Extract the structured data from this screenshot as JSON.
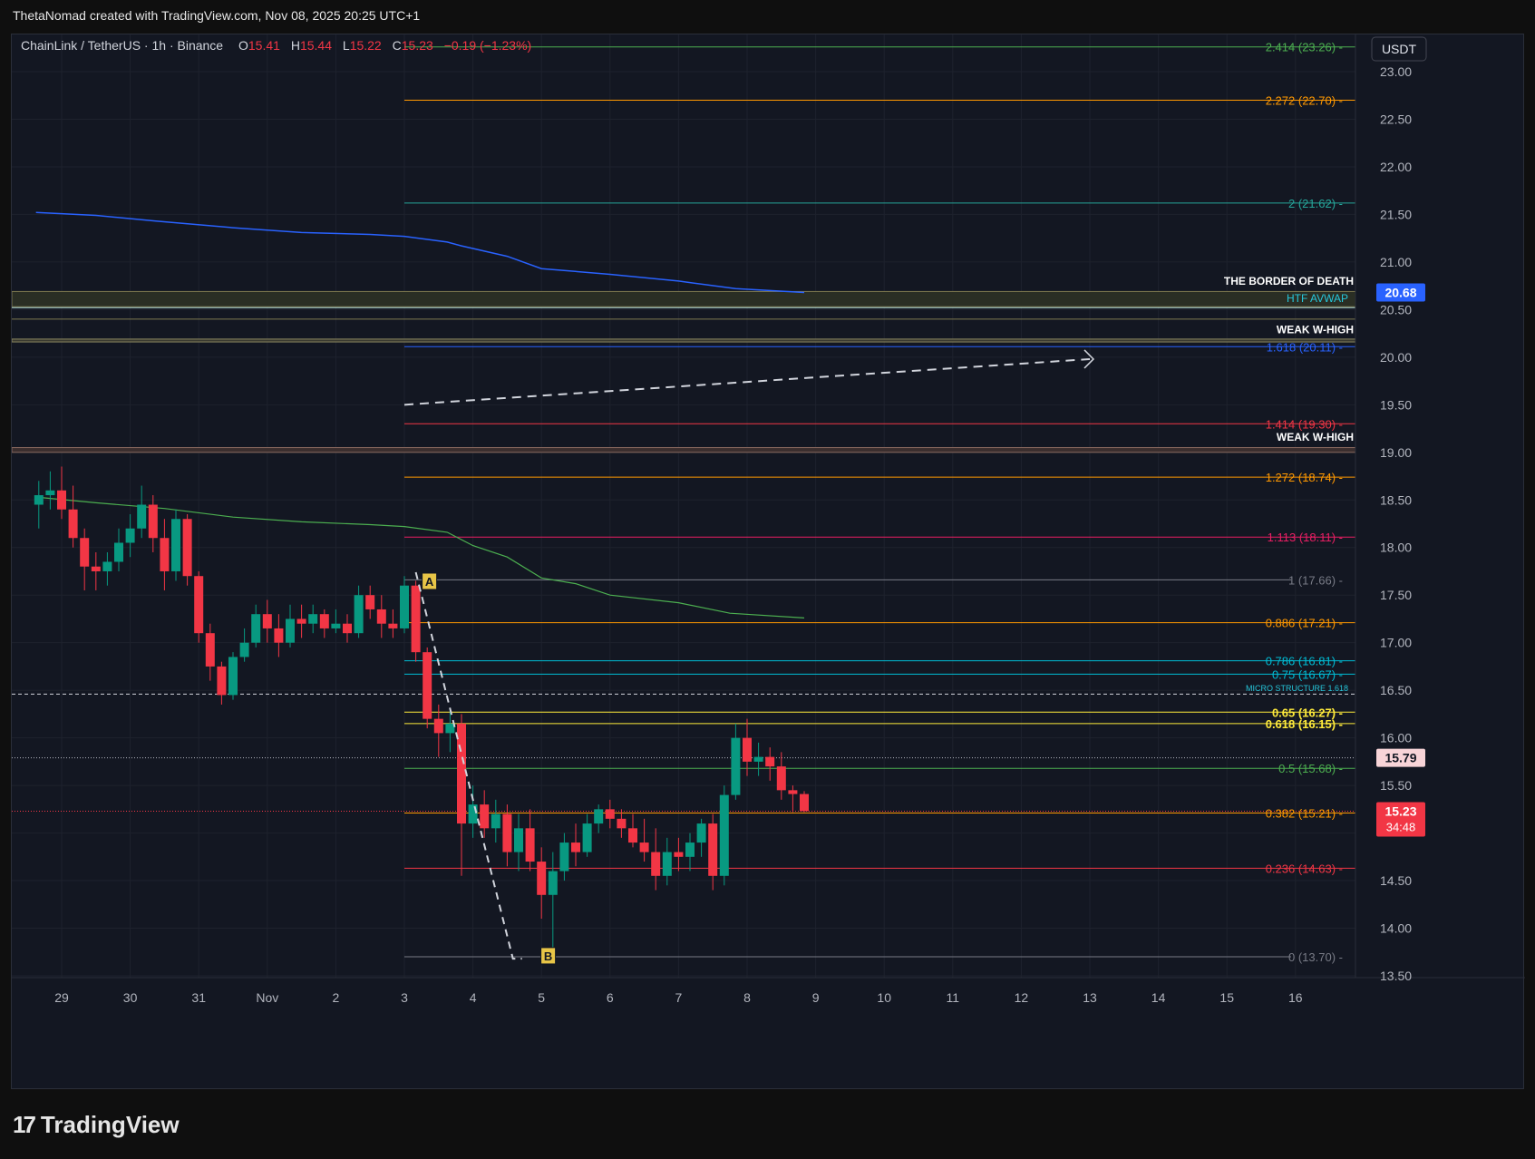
{
  "header": {
    "credit": "ThetaNomad created with TradingView.com, Nov 08, 2025 20:25 UTC+1"
  },
  "legend": {
    "symbol": "ChainLink / TetherUS · 1h · Binance",
    "o_label": "O",
    "o_value": "15.41",
    "h_label": "H",
    "h_value": "15.44",
    "l_label": "L",
    "l_value": "15.22",
    "c_label": "C",
    "c_value": "15.23",
    "change": "−0.19 (−1.23%)"
  },
  "price_axis": {
    "currency_button": "USDT",
    "ticks": [
      "23.00",
      "22.50",
      "22.00",
      "21.50",
      "21.00",
      "20.50",
      "20.00",
      "19.50",
      "19.00",
      "18.50",
      "18.00",
      "17.50",
      "17.00",
      "16.50",
      "16.00",
      "15.50",
      "14.50",
      "14.00",
      "13.50"
    ],
    "tag_avwap": "20.68",
    "tag_marker": "15.79",
    "tag_last": "15.23",
    "tag_countdown": "34:48"
  },
  "time_axis": {
    "labels": [
      "29",
      "30",
      "31",
      "Nov",
      "2",
      "3",
      "4",
      "5",
      "6",
      "7",
      "8",
      "9",
      "10",
      "11",
      "12",
      "13",
      "14",
      "15",
      "16"
    ]
  },
  "fib_levels": [
    {
      "label": "2.414 (23.26)",
      "price": 23.26,
      "color": "#4caf50"
    },
    {
      "label": "2.272 (22.70)",
      "price": 22.7,
      "color": "#ff9800"
    },
    {
      "label": "2 (21.62)",
      "price": 21.62,
      "color": "#26a69a"
    },
    {
      "label": "1.618 (20.11)",
      "price": 20.11,
      "color": "#2962ff"
    },
    {
      "label": "1.414 (19.30)",
      "price": 19.3,
      "color": "#f23645"
    },
    {
      "label": "1.272 (18.74)",
      "price": 18.74,
      "color": "#ff9800"
    },
    {
      "label": "1.113 (18.11)",
      "price": 18.11,
      "color": "#e91e63"
    },
    {
      "label": "1 (17.66)",
      "price": 17.66,
      "color": "#787b86"
    },
    {
      "label": "0.886 (17.21)",
      "price": 17.21,
      "color": "#ff9800"
    },
    {
      "label": "0.786 (16.81)",
      "price": 16.81,
      "color": "#00bcd4"
    },
    {
      "label": "0.75 (16.67)",
      "price": 16.67,
      "color": "#00bcd4"
    },
    {
      "label": "0.65 (16.27)",
      "price": 16.27,
      "color": "#ffeb3b"
    },
    {
      "label": "0.618 (16.15)",
      "price": 16.15,
      "color": "#ffeb3b"
    },
    {
      "label": "0.5 (15.68)",
      "price": 15.68,
      "color": "#4caf50"
    },
    {
      "label": "0.382 (15.21)",
      "price": 15.21,
      "color": "#ff9800"
    },
    {
      "label": "0.236 (14.63)",
      "price": 14.63,
      "color": "#f23645"
    },
    {
      "label": "0 (13.70)",
      "price": 13.7,
      "color": "#787b86"
    }
  ],
  "annotations": {
    "border_of_death": "THE BORDER OF DEATH",
    "htf_avwap": "HTF AVWAP",
    "weak_w_high_1": "WEAK W-HIGH",
    "weak_w_high_2": "WEAK W-HIGH",
    "micro_structure": "MICRO STRUCTURE 1.618",
    "point_a": "A",
    "point_b": "B"
  },
  "chart_data": {
    "type": "candlestick",
    "title": "ChainLink / TetherUS · 1h · Binance",
    "xlabel": "",
    "ylabel": "",
    "ylim": [
      13.4,
      23.3
    ],
    "x_range": [
      "Oct 28 15:00",
      "Nov 16 20:00"
    ],
    "last_price": 15.23,
    "ohlc_last": {
      "open": 15.41,
      "high": 15.44,
      "low": 15.22,
      "close": 15.23
    },
    "colors": {
      "up": "#089981",
      "down": "#f23645",
      "avwap": "#2962ff",
      "ma": "#4caf50"
    },
    "avwap_line": [
      [
        "Oct 28 15:00",
        21.52
      ],
      [
        "Oct 29 12:00",
        21.49
      ],
      [
        "Oct 30 09:00",
        21.43
      ],
      [
        "Oct 31 12:00",
        21.36
      ],
      [
        "Nov 01 12:00",
        21.31
      ],
      [
        "Nov 02 12:00",
        21.29
      ],
      [
        "Nov 03 00:00",
        21.27
      ],
      [
        "Nov 03 15:00",
        21.21
      ],
      [
        "Nov 03 20:00",
        21.17
      ],
      [
        "Nov 04 12:00",
        21.06
      ],
      [
        "Nov 05 00:00",
        20.93
      ],
      [
        "Nov 06 00:00",
        20.87
      ],
      [
        "Nov 07 00:00",
        20.8
      ],
      [
        "Nov 07 20:00",
        20.72
      ],
      [
        "Nov 08 20:00",
        20.68
      ]
    ],
    "ma_line": [
      [
        "Oct 28 15:00",
        18.53
      ],
      [
        "Oct 29 12:00",
        18.47
      ],
      [
        "Oct 30 12:00",
        18.41
      ],
      [
        "Oct 31 12:00",
        18.32
      ],
      [
        "Nov 01 12:00",
        18.27
      ],
      [
        "Nov 02 12:00",
        18.24
      ],
      [
        "Nov 03 00:00",
        18.22
      ],
      [
        "Nov 03 15:00",
        18.16
      ],
      [
        "Nov 04 00:00",
        18.02
      ],
      [
        "Nov 04 12:00",
        17.9
      ],
      [
        "Nov 05 00:00",
        17.68
      ],
      [
        "Nov 05 12:00",
        17.62
      ],
      [
        "Nov 06 00:00",
        17.5
      ],
      [
        "Nov 07 00:00",
        17.42
      ],
      [
        "Nov 07 18:00",
        17.31
      ],
      [
        "Nov 08 20:00",
        17.26
      ]
    ],
    "candles": [
      [
        "Oct 28 16:00",
        18.45,
        18.7,
        18.2,
        18.55
      ],
      [
        "Oct 28 20:00",
        18.55,
        18.8,
        18.4,
        18.6
      ],
      [
        "Oct 29 00:00",
        18.6,
        18.85,
        18.3,
        18.4
      ],
      [
        "Oct 29 04:00",
        18.4,
        18.65,
        18.0,
        18.1
      ],
      [
        "Oct 29 08:00",
        18.1,
        18.2,
        17.55,
        17.8
      ],
      [
        "Oct 29 12:00",
        17.8,
        17.95,
        17.55,
        17.75
      ],
      [
        "Oct 29 16:00",
        17.75,
        17.95,
        17.6,
        17.85
      ],
      [
        "Oct 29 20:00",
        17.85,
        18.2,
        17.75,
        18.05
      ],
      [
        "Oct 30 00:00",
        18.05,
        18.35,
        17.9,
        18.2
      ],
      [
        "Oct 30 04:00",
        18.2,
        18.65,
        18.1,
        18.45
      ],
      [
        "Oct 30 08:00",
        18.45,
        18.55,
        17.95,
        18.1
      ],
      [
        "Oct 30 12:00",
        18.1,
        18.3,
        17.55,
        17.75
      ],
      [
        "Oct 30 16:00",
        17.75,
        18.4,
        17.65,
        18.3
      ],
      [
        "Oct 30 20:00",
        18.3,
        18.35,
        17.6,
        17.7
      ],
      [
        "Oct 31 00:00",
        17.7,
        17.75,
        17.0,
        17.1
      ],
      [
        "Oct 31 04:00",
        17.1,
        17.2,
        16.6,
        16.75
      ],
      [
        "Oct 31 08:00",
        16.75,
        16.8,
        16.35,
        16.45
      ],
      [
        "Oct 31 12:00",
        16.45,
        16.9,
        16.4,
        16.85
      ],
      [
        "Oct 31 16:00",
        16.85,
        17.15,
        16.8,
        17.0
      ],
      [
        "Oct 31 20:00",
        17.0,
        17.4,
        16.95,
        17.3
      ],
      [
        "Nov 01 00:00",
        17.3,
        17.45,
        17.0,
        17.15
      ],
      [
        "Nov 01 04:00",
        17.15,
        17.3,
        16.85,
        17.0
      ],
      [
        "Nov 01 08:00",
        17.0,
        17.4,
        16.95,
        17.25
      ],
      [
        "Nov 01 12:00",
        17.25,
        17.4,
        17.05,
        17.2
      ],
      [
        "Nov 01 16:00",
        17.2,
        17.4,
        17.1,
        17.3
      ],
      [
        "Nov 01 20:00",
        17.3,
        17.35,
        17.05,
        17.15
      ],
      [
        "Nov 02 00:00",
        17.15,
        17.35,
        17.1,
        17.2
      ],
      [
        "Nov 02 04:00",
        17.2,
        17.3,
        17.0,
        17.1
      ],
      [
        "Nov 02 08:00",
        17.1,
        17.6,
        17.05,
        17.5
      ],
      [
        "Nov 02 12:00",
        17.5,
        17.6,
        17.25,
        17.35
      ],
      [
        "Nov 02 16:00",
        17.35,
        17.5,
        17.05,
        17.2
      ],
      [
        "Nov 02 20:00",
        17.2,
        17.35,
        17.05,
        17.15
      ],
      [
        "Nov 03 00:00",
        17.15,
        17.7,
        17.1,
        17.6
      ],
      [
        "Nov 03 04:00",
        17.6,
        17.65,
        16.8,
        16.9
      ],
      [
        "Nov 03 08:00",
        16.9,
        16.95,
        16.1,
        16.2
      ],
      [
        "Nov 03 12:00",
        16.2,
        16.35,
        15.8,
        16.05
      ],
      [
        "Nov 03 16:00",
        16.05,
        16.3,
        15.85,
        16.15
      ],
      [
        "Nov 03 20:00",
        16.15,
        16.25,
        14.55,
        15.1
      ],
      [
        "Nov 04 00:00",
        15.1,
        15.5,
        14.95,
        15.3
      ],
      [
        "Nov 04 04:00",
        15.3,
        15.45,
        14.95,
        15.05
      ],
      [
        "Nov 04 08:00",
        15.05,
        15.35,
        14.9,
        15.2
      ],
      [
        "Nov 04 12:00",
        15.2,
        15.3,
        14.65,
        14.8
      ],
      [
        "Nov 04 16:00",
        14.8,
        15.2,
        14.6,
        15.05
      ],
      [
        "Nov 04 20:00",
        15.05,
        15.25,
        14.6,
        14.7
      ],
      [
        "Nov 05 00:00",
        14.7,
        14.85,
        14.1,
        14.35
      ],
      [
        "Nov 05 04:00",
        14.35,
        14.8,
        13.72,
        14.6
      ],
      [
        "Nov 05 08:00",
        14.6,
        15.0,
        14.5,
        14.9
      ],
      [
        "Nov 05 12:00",
        14.9,
        15.1,
        14.65,
        14.8
      ],
      [
        "Nov 05 16:00",
        14.8,
        15.2,
        14.75,
        15.1
      ],
      [
        "Nov 05 20:00",
        15.1,
        15.3,
        15.0,
        15.25
      ],
      [
        "Nov 06 00:00",
        15.25,
        15.35,
        15.05,
        15.15
      ],
      [
        "Nov 06 04:00",
        15.15,
        15.25,
        14.95,
        15.05
      ],
      [
        "Nov 06 08:00",
        15.05,
        15.2,
        14.85,
        14.9
      ],
      [
        "Nov 06 12:00",
        14.9,
        15.15,
        14.7,
        14.8
      ],
      [
        "Nov 06 16:00",
        14.8,
        15.05,
        14.4,
        14.55
      ],
      [
        "Nov 06 20:00",
        14.55,
        14.95,
        14.45,
        14.8
      ],
      [
        "Nov 07 00:00",
        14.8,
        14.95,
        14.6,
        14.75
      ],
      [
        "Nov 07 04:00",
        14.75,
        15.0,
        14.6,
        14.9
      ],
      [
        "Nov 07 08:00",
        14.9,
        15.15,
        14.75,
        15.1
      ],
      [
        "Nov 07 12:00",
        15.1,
        15.2,
        14.4,
        14.55
      ],
      [
        "Nov 07 16:00",
        14.55,
        15.5,
        14.45,
        15.4
      ],
      [
        "Nov 07 20:00",
        15.4,
        16.15,
        15.35,
        16.0
      ],
      [
        "Nov 08 00:00",
        16.0,
        16.2,
        15.6,
        15.75
      ],
      [
        "Nov 08 04:00",
        15.75,
        15.95,
        15.6,
        15.8
      ],
      [
        "Nov 08 08:00",
        15.8,
        15.9,
        15.55,
        15.7
      ],
      [
        "Nov 08 12:00",
        15.7,
        15.85,
        15.35,
        15.45
      ],
      [
        "Nov 08 16:00",
        15.45,
        15.5,
        15.22,
        15.41
      ],
      [
        "Nov 08 20:00",
        15.41,
        15.44,
        15.22,
        15.23
      ]
    ]
  }
}
